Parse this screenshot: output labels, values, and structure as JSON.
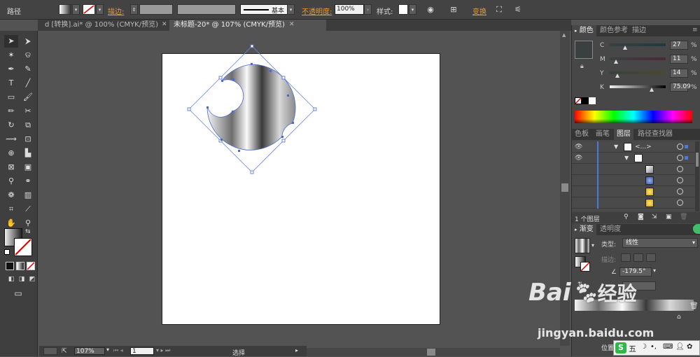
{
  "control_bar": {
    "object_type": "路径",
    "stroke_label": "描边:",
    "stroke_style": "基本",
    "opacity_label": "不透明度:",
    "opacity_value": "100%",
    "style_label": "样式:",
    "transform_label": "变换"
  },
  "tabs": [
    {
      "label": "d [转换].ai* @ 100% (CMYK/预览)"
    },
    {
      "label": "未标题-20* @ 107% (CMYK/预览)"
    }
  ],
  "status": {
    "zoom": "107%",
    "artboard": "1",
    "mode": "选择"
  },
  "color_panel": {
    "tabs": [
      "颜色",
      "颜色参考",
      "描边"
    ],
    "channels": [
      {
        "name": "C",
        "value": "27",
        "unit": "%",
        "fraction": 0.27
      },
      {
        "name": "M",
        "value": "11",
        "unit": "%",
        "fraction": 0.11
      },
      {
        "name": "Y",
        "value": "14",
        "unit": "%",
        "fraction": 0.14
      },
      {
        "name": "K",
        "value": "75.09",
        "unit": "%",
        "fraction": 0.75
      }
    ],
    "swatch_color": "#3a4040"
  },
  "layers_panel": {
    "tabs": [
      "色板",
      "画笔",
      "图层",
      "路径查找器"
    ],
    "rows": [
      {
        "name": "<...>"
      },
      {
        "name": ""
      },
      {
        "name": ""
      },
      {
        "name": ""
      },
      {
        "name": ""
      },
      {
        "name": ""
      }
    ],
    "count_label": "1 个图层"
  },
  "gradient_panel": {
    "tabs": [
      "渐变",
      "透明度"
    ],
    "type_label": "类型:",
    "type_value": "线性",
    "stroke_label": "描边:",
    "angle_value": "-179.5°",
    "location_label": "位置"
  },
  "watermark": {
    "brand": "Bai",
    "brand_suffix": "经验",
    "url": "jingyan.baidu.com"
  },
  "taskbar": {
    "ime_char": "五"
  }
}
